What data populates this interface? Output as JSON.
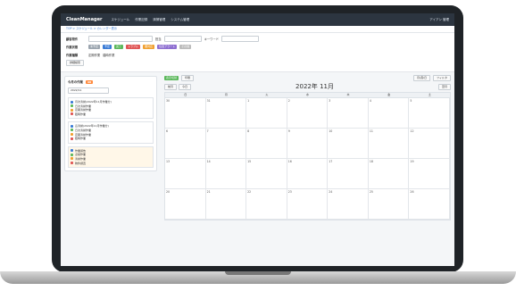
{
  "app": {
    "brand": "CleanManager",
    "menu": [
      "スケジュール",
      "作業記録",
      "清掃管理",
      "システム管理"
    ],
    "right": [
      "アイアン 管理"
    ]
  },
  "breadcrumb": "TOP > スケジュール > カレンダー表示",
  "filters": {
    "row1_label": "顧客物件",
    "row1_label2": "担当",
    "row1_label3": "キーワード",
    "row2_label": "作業状態",
    "row2_chips": [
      "未予定",
      "予定",
      "完了",
      "トラブル",
      "要対応",
      "位置アラート",
      "その他"
    ],
    "row3_label": "作業種類",
    "row3_items": [
      "定期作業",
      "臨時作業"
    ],
    "detail_button": "詳細検索"
  },
  "side": {
    "panel_title": "今月の作業",
    "badge": "98",
    "date": "2022/11",
    "list1": [
      "月次清掃(2022年11月作業分)",
      "日次清掃作業",
      "定期清掃作業",
      "臨時作業"
    ],
    "list2": [
      "窓清掃(2022年11月作業分)",
      "日次清掃作業",
      "定期清掃作業",
      "臨時作業"
    ],
    "list3": [
      "作業報告",
      "点検作業",
      "清掃作業",
      "物件調査"
    ]
  },
  "calendar": {
    "tools": [
      "表示切替",
      "印刷"
    ],
    "right_tools": [
      "月/週/日",
      "フィルタ"
    ],
    "nav": [
      "前月",
      "今日",
      "翌月"
    ],
    "month": "2022年 11月",
    "weekdays": [
      "日",
      "月",
      "火",
      "水",
      "木",
      "金",
      "土"
    ],
    "weeks": [
      {
        "days": [
          "30",
          "31",
          "1",
          "2",
          "3",
          "4",
          "5"
        ]
      },
      {
        "days": [
          "6",
          "7",
          "8",
          "9",
          "10",
          "11",
          "12"
        ]
      },
      {
        "days": [
          "13",
          "14",
          "15",
          "16",
          "17",
          "18",
          "19"
        ]
      },
      {
        "days": [
          "20",
          "21",
          "22",
          "23",
          "24",
          "25",
          "26"
        ]
      }
    ]
  },
  "colors": {
    "header": "#2c3540",
    "accent": "#3a7bd5",
    "green": "#5cb85c",
    "orange": "#f0a030",
    "red": "#e05656"
  }
}
